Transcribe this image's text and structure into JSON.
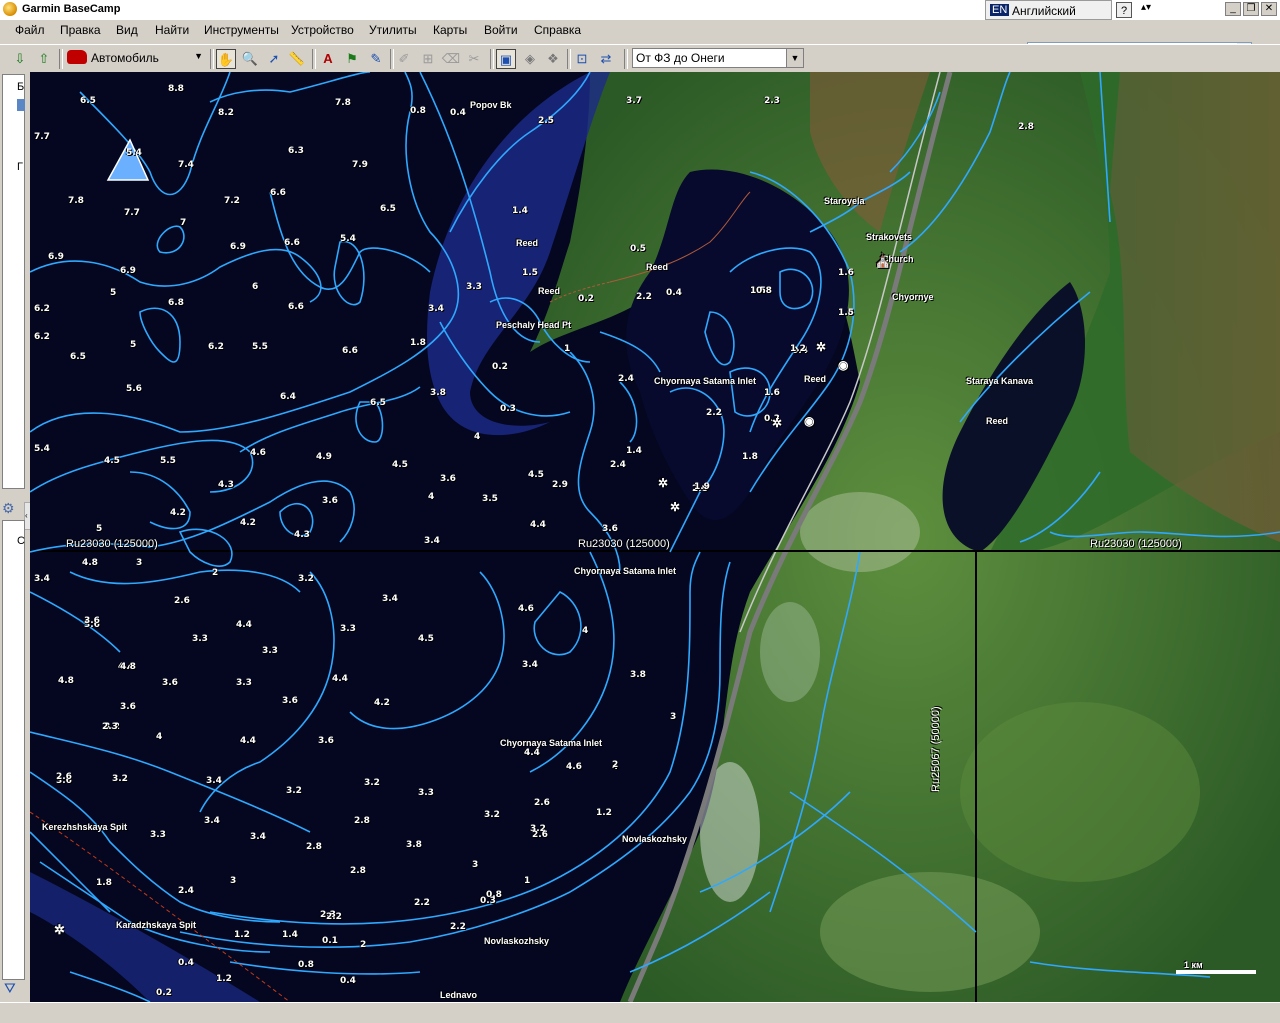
{
  "window": {
    "title": "Garmin BaseCamp"
  },
  "language": {
    "code": "EN",
    "name": "Английский (США)"
  },
  "help_label": "?",
  "menu": [
    "Файл",
    "Правка",
    "Вид",
    "Найти",
    "Инструменты",
    "Устройство",
    "Утилиты",
    "Карты",
    "Войти",
    "Справка"
  ],
  "search": {
    "value": ""
  },
  "toolbar": {
    "profile": "Автомобиль",
    "route": "От ФЗ до Онеги"
  },
  "left_panel": {
    "labels": [
      "Б",
      "Г",
      "С"
    ]
  },
  "map": {
    "tile_labels": [
      "Ru23030 (125000)",
      "Ru23030 (125000)",
      "Ru23030 (125000)",
      "Ru25067 (50000)"
    ],
    "place_names": [
      "Popov Bk",
      "Staroyela",
      "Strakovets",
      "Church",
      "Chyornye",
      "Reed",
      "Reed",
      "Reed",
      "Reed",
      "Reed",
      "Peschaly Head Pt",
      "Chyornaya Satama Inlet",
      "Chyornaya Satama Inlet",
      "Chyornaya Satama Inlet",
      "Staraya Kanava",
      "Novlaskozhsky",
      "Novlaskozhsky",
      "Kerezhshskaya Spit",
      "Karadzhskaya Spit",
      "Lednavo"
    ],
    "depths": [
      "6.5",
      "8.8",
      "7.8",
      "8.2",
      "7.7",
      "5.4",
      "6.3",
      "7.4",
      "7.9",
      "7",
      "7.8",
      "7.7",
      "7.2",
      "6.6",
      "7",
      "6.5",
      "6.9",
      "6.9",
      "6.6",
      "5.4",
      "6.9",
      "6",
      "5",
      "6.2",
      "6.8",
      "5",
      "6.2",
      "6.5",
      "6.2",
      "5.5",
      "6.6",
      "6.6",
      "5.6",
      "6.4",
      "6.5",
      "5.4",
      "6.3",
      "4.5",
      "5.5",
      "4.3",
      "4.6",
      "4.9",
      "4.5",
      "4.2",
      "4",
      "3.6",
      "3.6",
      "4.2",
      "5",
      "4.3",
      "3.4",
      "3.6",
      "4.5",
      "3.5",
      "4.8",
      "3",
      "2",
      "3.2",
      "2.6",
      "3.4",
      "3.6",
      "4.4",
      "3.3",
      "4.5",
      "4.4",
      "3.3",
      "3.3",
      "4.6",
      "4",
      "4.8",
      "4.4",
      "3.6",
      "3.6",
      "4.2",
      "3.4",
      "3.8",
      "4.8",
      "3.6",
      "3.3",
      "3.2",
      "4",
      "4.4",
      "3.6",
      "3.6",
      "3.2",
      "3.4",
      "3.2",
      "3.2",
      "3.3",
      "4.4",
      "4.6",
      "4",
      "3.4",
      "3.6",
      "2.3",
      "2.6",
      "3.3",
      "3.4",
      "2.8",
      "3.4",
      "2.8",
      "3.8",
      "3.2",
      "3.2",
      "2.8",
      "2.2",
      "2.3",
      "3",
      "2.6",
      "3",
      "2.4",
      "1.2",
      "1.4",
      "1.8",
      "0.4",
      "0.1",
      "2",
      "0.8",
      "1.2",
      "2.2",
      "2.2",
      "2.2",
      "0.4",
      "0.2",
      "0.8",
      "1",
      "0.3",
      "1.2",
      "2",
      "3",
      "2.6",
      "2.4",
      "2.8",
      "2.2",
      "1.8",
      "1.6",
      "1.4",
      "1.9",
      "1.5",
      "2.4",
      "1.4",
      "1.8",
      "2.5",
      "3.3",
      "0.3",
      "0.2",
      "0.5",
      "0.4",
      "0.3",
      "0.8",
      "0.4",
      "1.6",
      "1.5",
      "2.2",
      "1.2",
      "0.2",
      "0.2",
      "1",
      "1.5",
      "0.8",
      "0.4",
      "3.4",
      "3.8",
      "4",
      "1.8",
      "2.8",
      "2.3",
      "4.4",
      "3.7",
      "2.9",
      "2.5",
      "2.5",
      "3.2"
    ]
  },
  "scale": {
    "label": "1 км"
  },
  "colors": {
    "chrome": "#d4d0c8",
    "water": "#04071f",
    "contour": "#2fa8ff",
    "land": "#3e6a2e"
  }
}
